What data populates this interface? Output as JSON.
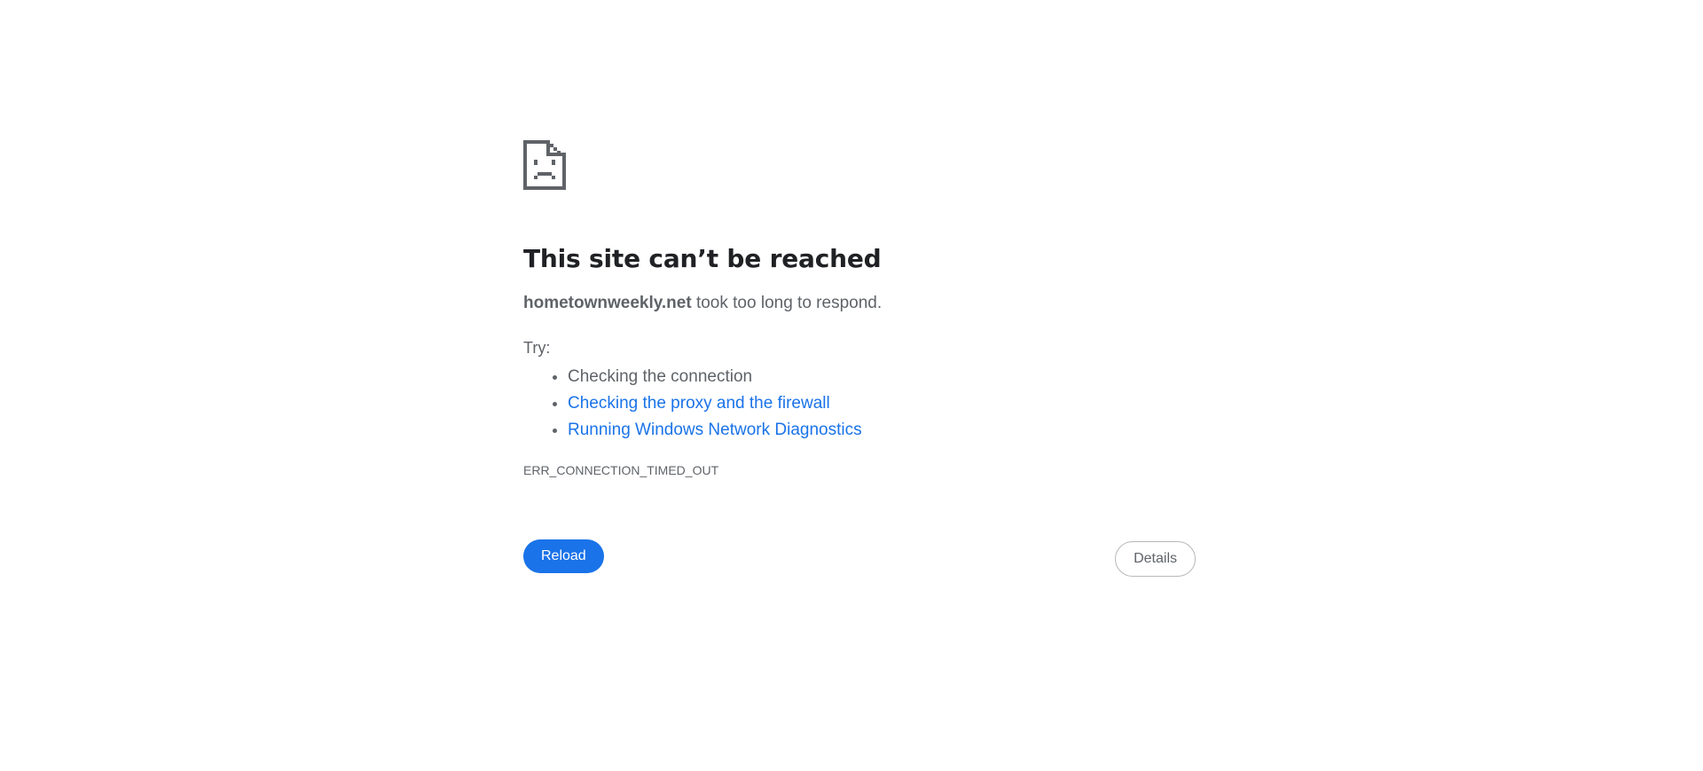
{
  "error": {
    "icon": "sad-document-icon",
    "title": "This site can’t be reached",
    "host": "hometownweekly.net",
    "message": " took too long to respond.",
    "try_label": "Try:",
    "suggestions": [
      {
        "label": "Checking the connection",
        "is_link": false
      },
      {
        "label": "Checking the proxy and the firewall",
        "is_link": true
      },
      {
        "label": "Running Windows Network Diagnostics",
        "is_link": true
      }
    ],
    "code": "ERR_CONNECTION_TIMED_OUT"
  },
  "buttons": {
    "reload_label": "Reload",
    "details_label": "Details"
  },
  "colors": {
    "accent": "#1a73e8",
    "heading": "#202124",
    "body_text": "#5f6368"
  }
}
